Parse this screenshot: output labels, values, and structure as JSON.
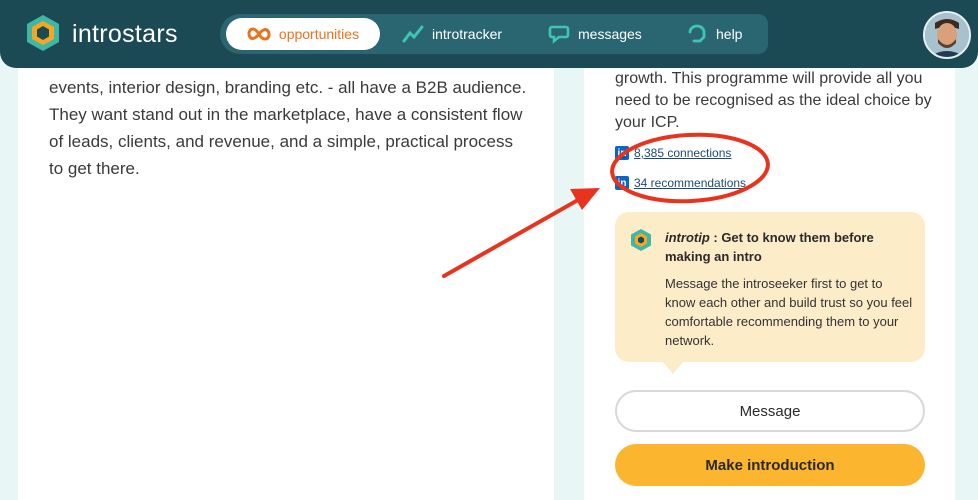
{
  "brand": {
    "name": "introstars"
  },
  "nav": {
    "items": [
      {
        "label": "opportunities",
        "icon": "infinity-icon",
        "active": true
      },
      {
        "label": "introtracker",
        "icon": "trend-icon"
      },
      {
        "label": "messages",
        "icon": "chat-icon"
      },
      {
        "label": "help",
        "icon": "help-icon"
      }
    ]
  },
  "left": {
    "description": "events, interior design, branding etc. - all have a B2B audience. They want stand out in the marketplace, have a consistent flow of leads, clients, and revenue, and a simple, practical process to get there."
  },
  "right": {
    "description": "growth. This programme will provide all you need to be recognised as the ideal choice by your ICP.",
    "connections": "8,385 connections",
    "recommendations": "34 recommendations",
    "linkedin_badge": "in"
  },
  "tip": {
    "title_italic": "introtip",
    "title_rest": " : Get to know them before making an intro",
    "body": "Message the introseeker first to get to know each other and build trust so you feel comfortable recommending them to your network."
  },
  "buttons": {
    "message": "Message",
    "introduce": "Make introduction"
  },
  "colors": {
    "nav_bg": "#1b4a55",
    "accent_orange": "#e8741d",
    "primary_button": "#fbb52f",
    "tip_bg": "#fcecc8",
    "annotation_red": "#e8331f"
  }
}
